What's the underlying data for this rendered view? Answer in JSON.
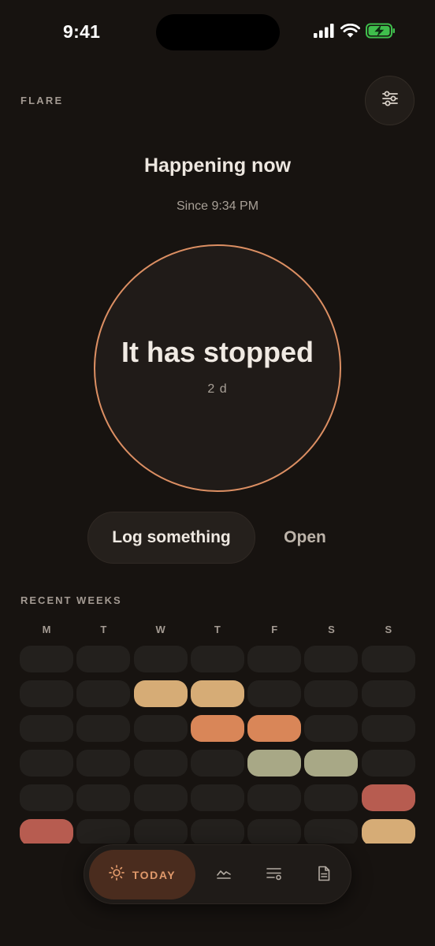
{
  "status_bar": {
    "time": "9:41",
    "icons": [
      "signal-icon",
      "wifi-icon",
      "battery-charging-icon"
    ],
    "battery_color": "#3fbe4c"
  },
  "header": {
    "app_name": "FLARE",
    "filter_icon": "sliders-icon"
  },
  "current": {
    "headline": "Happening now",
    "since": "Since 9:34 PM",
    "ring_title": "It has stopped",
    "ring_subtitle": "2 d",
    "ring_color": "#dc8f63"
  },
  "actions": {
    "log_label": "Log something",
    "open_label": "Open"
  },
  "recent_weeks": {
    "label": "RECENT WEEKS",
    "days": [
      "M",
      "T",
      "W",
      "T",
      "F",
      "S",
      "S"
    ],
    "palette": {
      "empty": "#23201d",
      "sand": "#d6ac76",
      "orange": "#d98658",
      "sage": "#a8a886",
      "red": "#b75c50"
    },
    "weeks": [
      [
        "empty",
        "empty",
        "empty",
        "empty",
        "empty",
        "empty",
        "empty"
      ],
      [
        "empty",
        "empty",
        "sand",
        "sand",
        "empty",
        "empty",
        "empty"
      ],
      [
        "empty",
        "empty",
        "empty",
        "orange",
        "orange",
        "empty",
        "empty"
      ],
      [
        "empty",
        "empty",
        "empty",
        "empty",
        "sage",
        "sage",
        "empty"
      ],
      [
        "empty",
        "empty",
        "empty",
        "empty",
        "empty",
        "empty",
        "red"
      ],
      [
        "red",
        "empty",
        "empty",
        "empty",
        "empty",
        "empty",
        "sand"
      ]
    ]
  },
  "nav": {
    "active_label": "TODAY",
    "items": [
      {
        "name": "today",
        "icon": "sun-icon",
        "active": true
      },
      {
        "name": "trends",
        "icon": "trend-line-icon",
        "active": false
      },
      {
        "name": "log",
        "icon": "list-settings-icon",
        "active": false
      },
      {
        "name": "report",
        "icon": "document-icon",
        "active": false
      }
    ]
  }
}
